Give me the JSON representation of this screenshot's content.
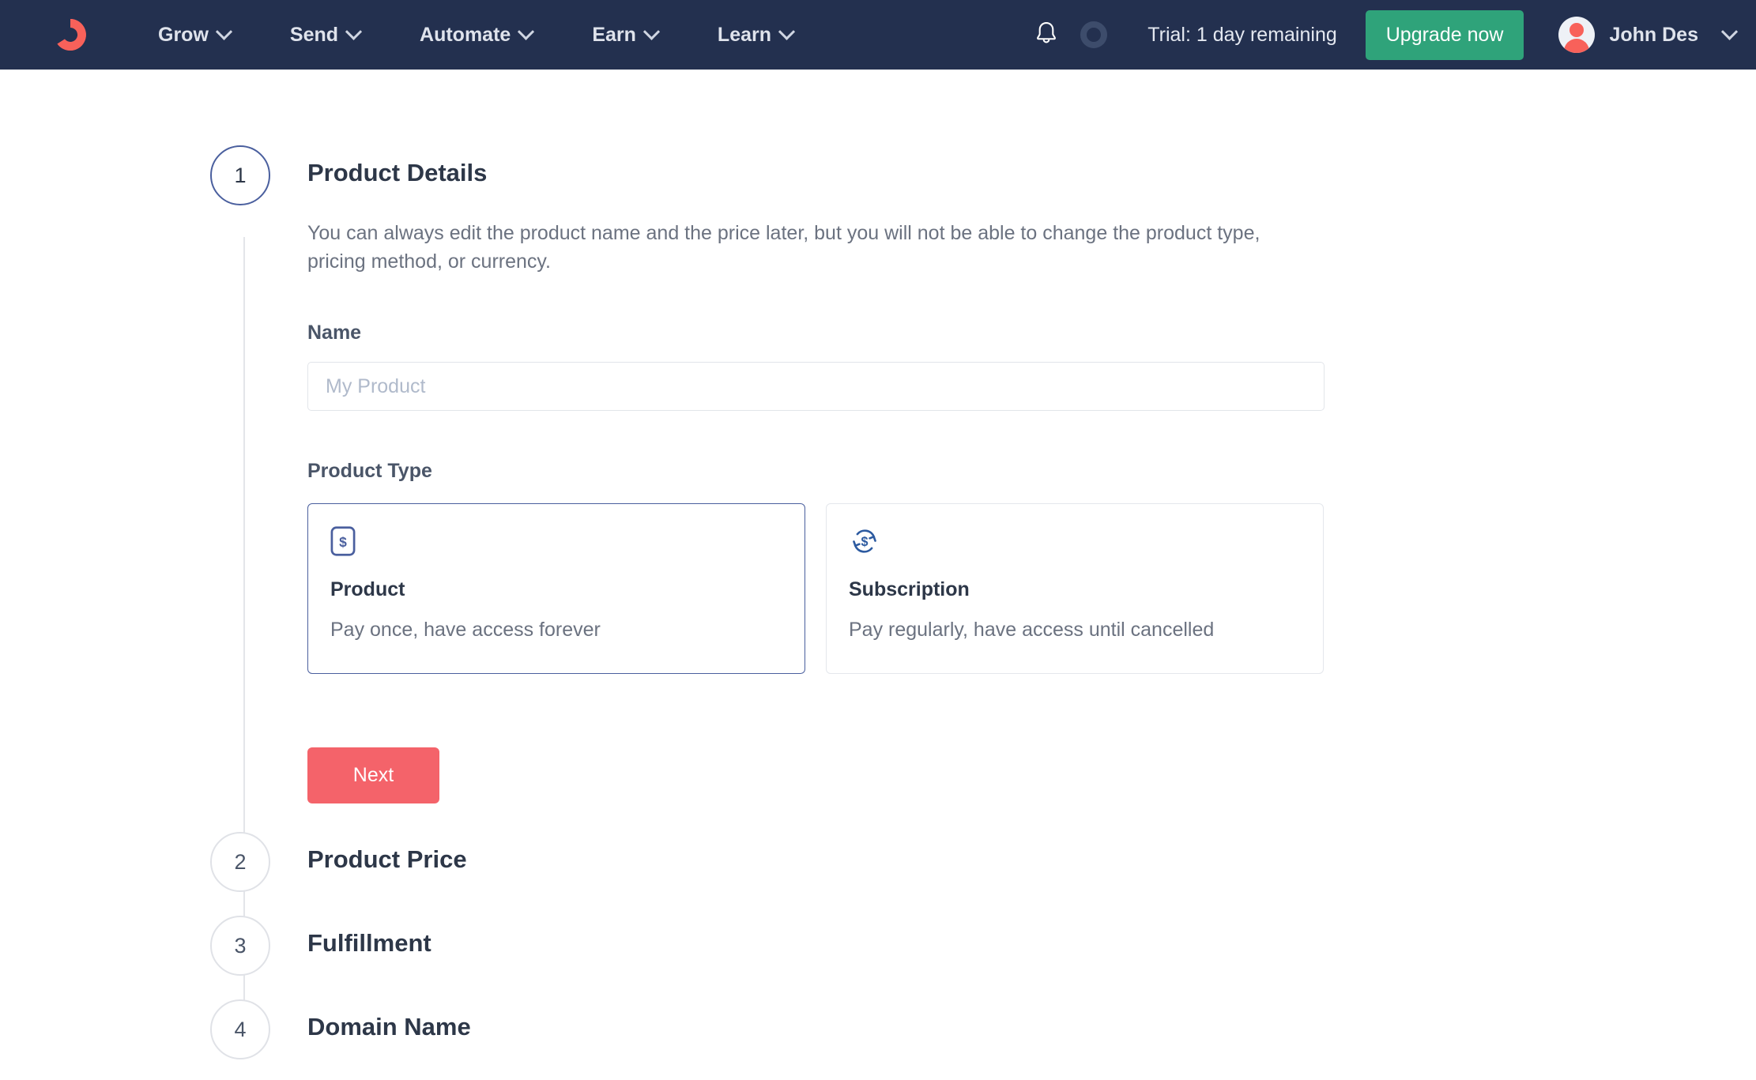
{
  "navbar": {
    "logo_name": "convertkit-logo",
    "brand_color": "#f8615a",
    "background": "#23304f",
    "links": [
      {
        "label": "Grow"
      },
      {
        "label": "Send"
      },
      {
        "label": "Automate"
      },
      {
        "label": "Earn"
      },
      {
        "label": "Learn"
      }
    ],
    "notifications_icon": "bell-icon",
    "status_ring_icon": "progress-ring-icon",
    "trial_text": "Trial: 1 day remaining",
    "upgrade_label": "Upgrade now",
    "upgrade_color": "#2fa37a",
    "user_name": "John Des"
  },
  "stepper": {
    "steps": [
      {
        "number": "1",
        "title": "Product Details",
        "active": true
      },
      {
        "number": "2",
        "title": "Product Price",
        "active": false
      },
      {
        "number": "3",
        "title": "Fulfillment",
        "active": false
      },
      {
        "number": "4",
        "title": "Domain Name",
        "active": false
      }
    ]
  },
  "step_one": {
    "description": "You can always edit the product name and the price later, but you will not be able to change the product type, pricing method, or currency.",
    "name_label": "Name",
    "name_value": "",
    "name_placeholder": "My Product",
    "product_type_label": "Product Type",
    "next_label": "Next",
    "next_color": "#f4636a",
    "selected_type": "Product",
    "types": [
      {
        "title": "Product",
        "subtitle": "Pay once, have access forever",
        "icon": "dollar-square-icon",
        "selected": true
      },
      {
        "title": "Subscription",
        "subtitle": "Pay regularly, have access until cancelled",
        "icon": "dollar-recurring-icon",
        "selected": false
      }
    ]
  }
}
